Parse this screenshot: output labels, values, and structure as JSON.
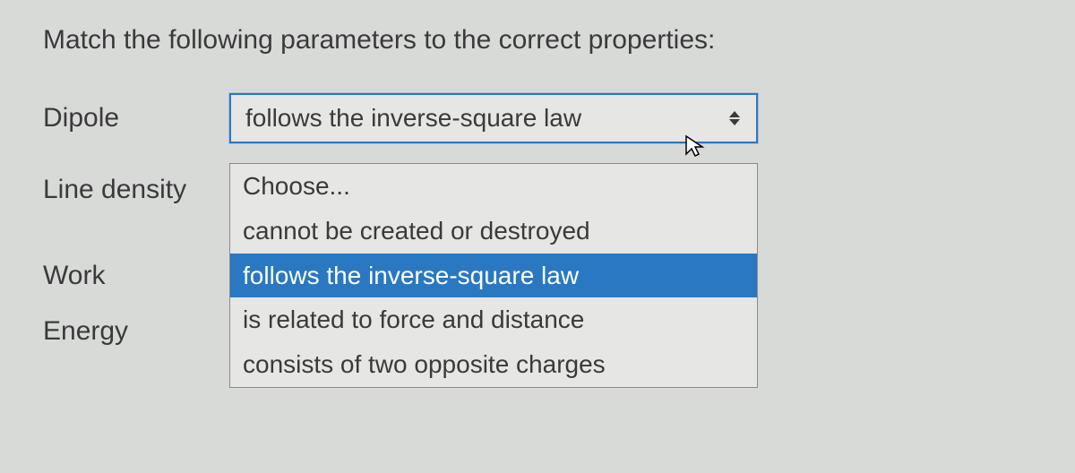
{
  "prompt": "Match the following parameters to the correct properties:",
  "labels": {
    "dipole": "Dipole",
    "line_density": "Line density",
    "work": "Work",
    "energy": "Energy"
  },
  "select": {
    "current_value": "follows the inverse-square law"
  },
  "dropdown": {
    "placeholder": "Choose...",
    "options": [
      "cannot be created or destroyed",
      "follows the inverse-square law",
      "is related to force and distance",
      "consists of two opposite charges"
    ],
    "highlighted_index": 1
  }
}
